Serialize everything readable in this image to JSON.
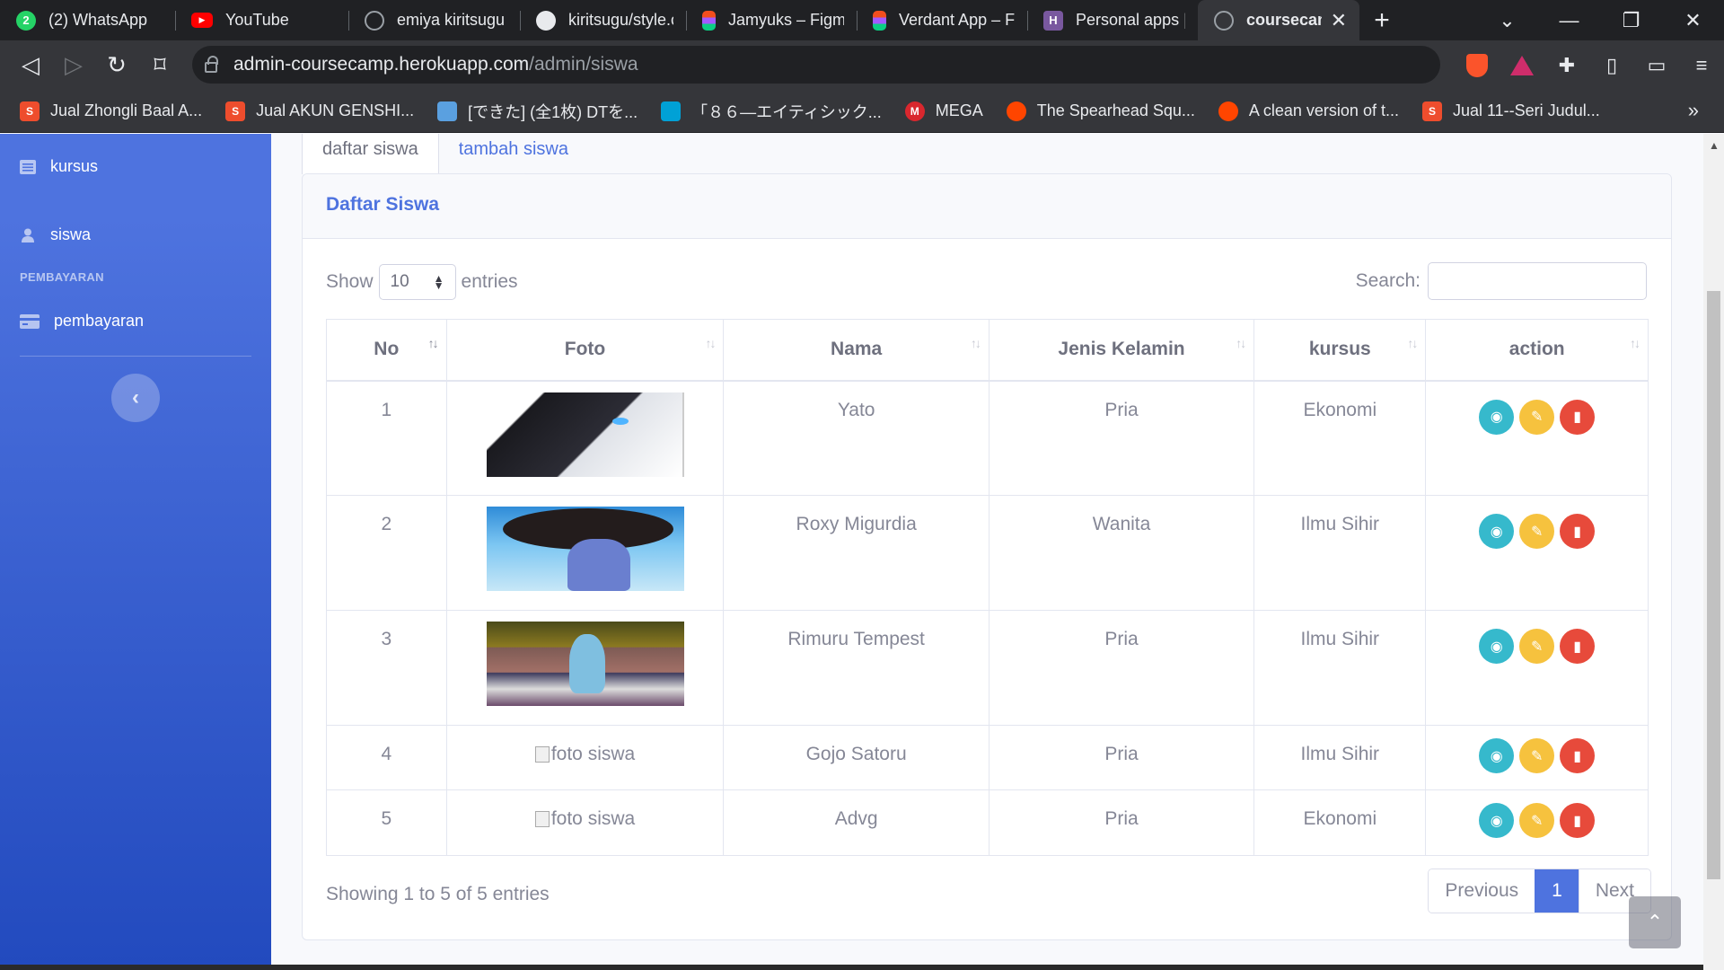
{
  "browser": {
    "tabs": [
      {
        "title": "(2) WhatsApp",
        "icon": "whatsapp-icon",
        "color": "#25d366",
        "glyph": "2"
      },
      {
        "title": "YouTube",
        "icon": "youtube-icon",
        "color": "#ff0000",
        "glyph": "▶"
      },
      {
        "title": "emiya kiritsugu",
        "icon": "globe-icon",
        "color": "#9aa0a6",
        "glyph": ""
      },
      {
        "title": "kiritsugu/style.cs",
        "icon": "github-icon",
        "color": "#e8eaed",
        "glyph": ""
      },
      {
        "title": "Jamyuks – Figma",
        "icon": "figma-icon",
        "color": "#f24e1e",
        "glyph": ""
      },
      {
        "title": "Verdant App – Fi",
        "icon": "figma-icon",
        "color": "#f24e1e",
        "glyph": ""
      },
      {
        "title": "Personal apps | H",
        "icon": "heroku-icon",
        "color": "#79589f",
        "glyph": "H"
      },
      {
        "title": "coursecamp",
        "icon": "globe-icon",
        "color": "#9aa0a6",
        "glyph": "",
        "active": true
      }
    ],
    "url_host": "admin-coursecamp.herokuapp.com",
    "url_path": "/admin/siswa",
    "bookmarks": [
      {
        "title": "Jual Zhongli Baal A...",
        "icon": "shopee-icon",
        "color": "#ee4d2d",
        "glyph": "S"
      },
      {
        "title": "Jual AKUN GENSHI...",
        "icon": "shopee-icon",
        "color": "#ee4d2d",
        "glyph": "S"
      },
      {
        "title": "[できた] (全1枚) DTを...",
        "icon": "cube-icon",
        "color": "#5aa0e0",
        "glyph": ""
      },
      {
        "title": "「８６―エイティシック...",
        "icon": "bilibili-icon",
        "color": "#00a1d6",
        "glyph": ""
      },
      {
        "title": "MEGA",
        "icon": "mega-icon",
        "color": "#d9272e",
        "glyph": "M"
      },
      {
        "title": "The Spearhead Squ...",
        "icon": "reddit-icon",
        "color": "#ff4500",
        "glyph": ""
      },
      {
        "title": "A clean version of t...",
        "icon": "reddit-icon",
        "color": "#ff4500",
        "glyph": ""
      },
      {
        "title": "Jual 11--Seri Judul...",
        "icon": "shopee-icon",
        "color": "#ee4d2d",
        "glyph": "S"
      }
    ]
  },
  "sidebar": {
    "items": [
      {
        "label": "kursus",
        "icon": "list-icon"
      },
      {
        "label": "siswa",
        "icon": "user-icon"
      },
      {
        "label": "pembayaran",
        "icon": "credit-card-icon"
      }
    ],
    "heading": "PEMBAYARAN",
    "toggle_glyph": "‹"
  },
  "tabs": {
    "list": "daftar siswa",
    "add": "tambah siswa"
  },
  "card": {
    "title": "Daftar Siswa"
  },
  "table_controls": {
    "show_label": "Show",
    "entries_label": "entries",
    "length_value": "10",
    "search_label": "Search:",
    "search_value": ""
  },
  "table": {
    "headers": [
      "No",
      "Foto",
      "Nama",
      "Jenis Kelamin",
      "kursus",
      "action"
    ],
    "rows": [
      {
        "no": "1",
        "photo": "yato",
        "alt": "",
        "nama": "Yato",
        "jk": "Pria",
        "kursus": "Ekonomi"
      },
      {
        "no": "2",
        "photo": "roxy",
        "alt": "",
        "nama": "Roxy Migurdia",
        "jk": "Wanita",
        "kursus": "Ilmu Sihir"
      },
      {
        "no": "3",
        "photo": "rimuru",
        "alt": "",
        "nama": "Rimuru Tempest",
        "jk": "Pria",
        "kursus": "Ilmu Sihir"
      },
      {
        "no": "4",
        "photo": "broken",
        "alt": "foto siswa",
        "nama": "Gojo Satoru",
        "jk": "Pria",
        "kursus": "Ilmu Sihir"
      },
      {
        "no": "5",
        "photo": "broken",
        "alt": "foto siswa",
        "nama": "Advg",
        "jk": "Pria",
        "kursus": "Ekonomi"
      }
    ]
  },
  "footer": {
    "info": "Showing 1 to 5 of 5 entries",
    "previous": "Previous",
    "page": "1",
    "next": "Next"
  },
  "colors": {
    "primary": "#4e73df",
    "info": "#36b9cc",
    "warning": "#f6c23e",
    "danger": "#e74a3b"
  }
}
